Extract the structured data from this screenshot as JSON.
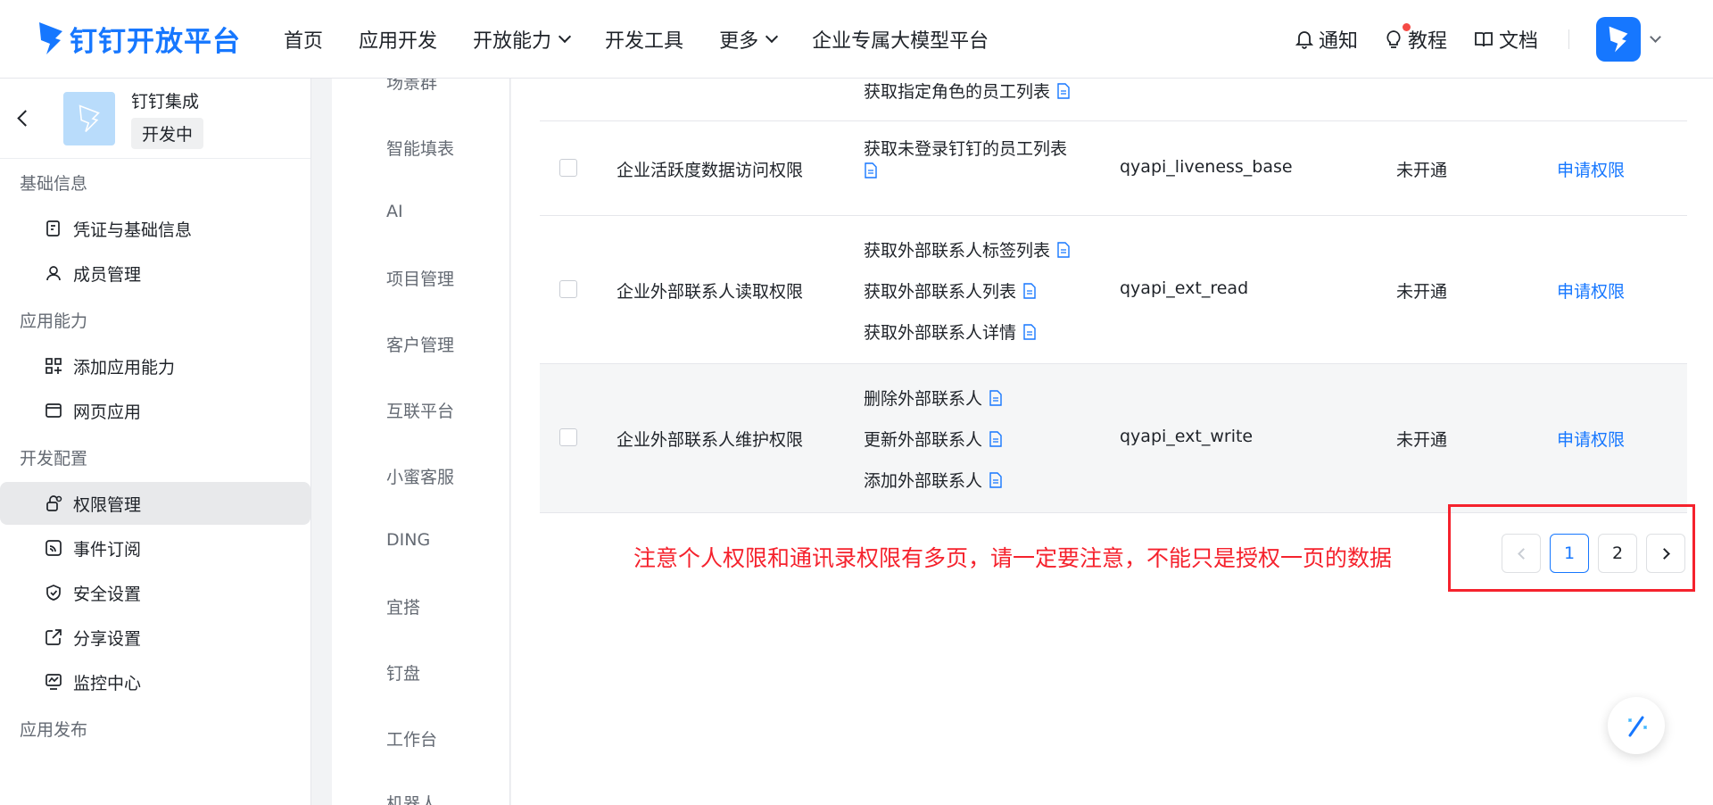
{
  "header": {
    "logo_text": "钉钉开放平台",
    "nav": [
      {
        "label": "首页"
      },
      {
        "label": "应用开发"
      },
      {
        "label": "开放能力",
        "dropdown": true
      },
      {
        "label": "开发工具"
      },
      {
        "label": "更多",
        "dropdown": true
      },
      {
        "label": "企业专属大模型平台"
      }
    ],
    "right": {
      "notify": "通知",
      "tutorial": "教程",
      "docs": "文档"
    }
  },
  "sidebar": {
    "app_name": "钉钉集成",
    "app_status": "开发中",
    "sections": [
      {
        "title": "基础信息",
        "items": [
          {
            "label": "凭证与基础信息",
            "icon": "credential-icon"
          },
          {
            "label": "成员管理",
            "icon": "user-icon"
          }
        ]
      },
      {
        "title": "应用能力",
        "items": [
          {
            "label": "添加应用能力",
            "icon": "grid-add-icon"
          },
          {
            "label": "网页应用",
            "icon": "browser-icon"
          }
        ]
      },
      {
        "title": "开发配置",
        "items": [
          {
            "label": "权限管理",
            "icon": "lock-icon",
            "active": true
          },
          {
            "label": "事件订阅",
            "icon": "rss-icon"
          },
          {
            "label": "安全设置",
            "icon": "shield-icon"
          },
          {
            "label": "分享设置",
            "icon": "share-icon"
          },
          {
            "label": "监控中心",
            "icon": "monitor-icon"
          }
        ]
      },
      {
        "title": "应用发布",
        "items": []
      }
    ]
  },
  "subnav": {
    "items": [
      "场景群",
      "智能填表",
      "AI",
      "项目管理",
      "客户管理",
      "互联平台",
      "小蜜客服",
      "DING",
      "宜搭",
      "钉盘",
      "工作台",
      "机器人"
    ]
  },
  "table": {
    "partial_row": {
      "apis": [
        "获取指定角色的员工列表"
      ]
    },
    "rows": [
      {
        "name": "企业活跃度数据访问权限",
        "apis": [
          "获取未登录钉钉的员工列表"
        ],
        "code": "qyapi_liveness_base",
        "status": "未开通",
        "action": "申请权限"
      },
      {
        "name": "企业外部联系人读取权限",
        "apis": [
          "获取外部联系人标签列表",
          "获取外部联系人列表",
          "获取外部联系人详情"
        ],
        "code": "qyapi_ext_read",
        "status": "未开通",
        "action": "申请权限"
      },
      {
        "name": "企业外部联系人维护权限",
        "apis": [
          "删除外部联系人",
          "更新外部联系人",
          "添加外部联系人"
        ],
        "code": "qyapi_ext_write",
        "status": "未开通",
        "action": "申请权限"
      }
    ]
  },
  "note": "注意个人权限和通讯录权限有多页，请一定要注意，不能只是授权一页的数据",
  "pagination": {
    "pages": [
      "1",
      "2"
    ],
    "current": "1"
  },
  "colors": {
    "accent": "#1677ff",
    "annotation": "#f5222d"
  }
}
